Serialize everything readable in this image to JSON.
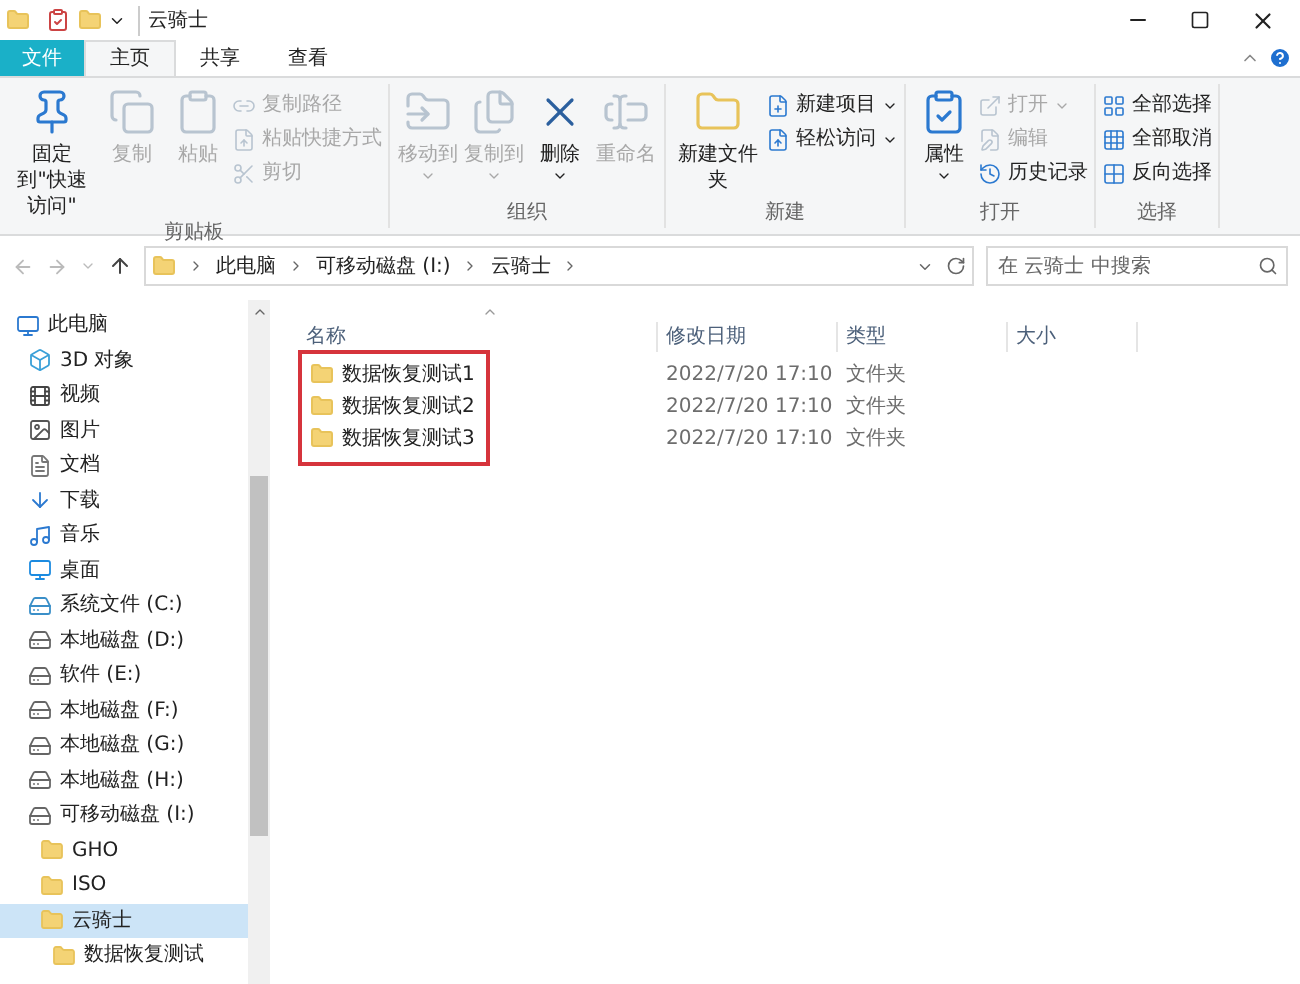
{
  "title_bar": {
    "title": "云骑士"
  },
  "tabs": [
    {
      "label": "文件",
      "kind": "file",
      "selected": false
    },
    {
      "label": "主页",
      "kind": "tab",
      "selected": true
    },
    {
      "label": "共享",
      "kind": "tab",
      "selected": false
    },
    {
      "label": "查看",
      "kind": "tab",
      "selected": false
    }
  ],
  "ribbon": [
    {
      "label": "剪贴板",
      "items": [
        {
          "label": "固定到\"快速访问\"",
          "kind": "large",
          "disabled": false,
          "dropdown": false
        },
        {
          "label": "复制",
          "kind": "large",
          "disabled": true,
          "dropdown": false
        },
        {
          "label": "粘贴",
          "kind": "large",
          "disabled": true,
          "dropdown": false
        },
        {
          "label": "复制路径",
          "kind": "small",
          "disabled": true,
          "dropdown": false
        },
        {
          "label": "粘贴快捷方式",
          "kind": "small",
          "disabled": true,
          "dropdown": false
        },
        {
          "label": "剪切",
          "kind": "small",
          "disabled": true,
          "dropdown": false
        }
      ]
    },
    {
      "label": "组织",
      "items": [
        {
          "label": "移动到",
          "kind": "large",
          "disabled": true,
          "dropdown": true
        },
        {
          "label": "复制到",
          "kind": "large",
          "disabled": true,
          "dropdown": true
        },
        {
          "label": "删除",
          "kind": "large",
          "disabled": false,
          "dropdown": true
        },
        {
          "label": "重命名",
          "kind": "large",
          "disabled": true,
          "dropdown": false
        }
      ]
    },
    {
      "label": "新建",
      "items": [
        {
          "label": "新建文件夹",
          "kind": "large",
          "disabled": false,
          "dropdown": false
        },
        {
          "label": "新建项目",
          "kind": "small",
          "disabled": false,
          "dropdown": true
        },
        {
          "label": "轻松访问",
          "kind": "small",
          "disabled": false,
          "dropdown": true
        }
      ]
    },
    {
      "label": "打开",
      "items": [
        {
          "label": "属性",
          "kind": "large",
          "disabled": false,
          "dropdown": true
        },
        {
          "label": "打开",
          "kind": "small",
          "disabled": true,
          "dropdown": true
        },
        {
          "label": "编辑",
          "kind": "small",
          "disabled": true,
          "dropdown": false
        },
        {
          "label": "历史记录",
          "kind": "small",
          "disabled": false,
          "dropdown": false
        }
      ]
    },
    {
      "label": "选择",
      "items": [
        {
          "label": "全部选择",
          "kind": "small",
          "disabled": false,
          "dropdown": false
        },
        {
          "label": "全部取消",
          "kind": "small",
          "disabled": false,
          "dropdown": false
        },
        {
          "label": "反向选择",
          "kind": "small",
          "disabled": false,
          "dropdown": false
        }
      ]
    }
  ],
  "address_bar": {
    "path": [
      "此电脑",
      "可移动磁盘 (I:)",
      "云骑士"
    ]
  },
  "search": {
    "placeholder": "在 云骑士 中搜索"
  },
  "sidebar": {
    "items": [
      {
        "label": "此电脑",
        "kind": "pc",
        "selected": false,
        "children": [
          {
            "label": "3D 对象",
            "kind": "object",
            "selected": false
          },
          {
            "label": "视频",
            "kind": "video",
            "selected": false
          },
          {
            "label": "图片",
            "kind": "picture",
            "selected": false
          },
          {
            "label": "文档",
            "kind": "document",
            "selected": false
          },
          {
            "label": "下载",
            "kind": "download",
            "selected": false
          },
          {
            "label": "音乐",
            "kind": "music",
            "selected": false
          },
          {
            "label": "桌面",
            "kind": "desktop",
            "selected": false
          },
          {
            "label": "系统文件 (C:)",
            "kind": "system-drive",
            "selected": false
          },
          {
            "label": "本地磁盘 (D:)",
            "kind": "drive",
            "selected": false
          },
          {
            "label": "软件 (E:)",
            "kind": "drive",
            "selected": false
          },
          {
            "label": "本地磁盘 (F:)",
            "kind": "drive",
            "selected": false
          },
          {
            "label": "本地磁盘 (G:)",
            "kind": "drive",
            "selected": false
          },
          {
            "label": "本地磁盘 (H:)",
            "kind": "drive",
            "selected": false
          },
          {
            "label": "可移动磁盘 (I:)",
            "kind": "drive",
            "selected": false,
            "children": [
              {
                "label": "GHO",
                "kind": "folder",
                "selected": false
              },
              {
                "label": "ISO",
                "kind": "folder",
                "selected": false
              },
              {
                "label": "云骑士",
                "kind": "folder",
                "selected": true,
                "children": [
                  {
                    "label": "数据恢复测试",
                    "kind": "folder",
                    "selected": false
                  }
                ]
              }
            ]
          }
        ]
      }
    ]
  },
  "table": {
    "columns": [
      "名称",
      "修改日期",
      "类型",
      "大小"
    ],
    "highlighted": true,
    "rows": [
      {
        "name": "数据恢复测试1",
        "modified": "2022/7/20 17:10",
        "type": "文件夹"
      },
      {
        "name": "数据恢复测试2",
        "modified": "2022/7/20 17:10",
        "type": "文件夹"
      },
      {
        "name": "数据恢复测试3",
        "modified": "2022/7/20 17:10",
        "type": "文件夹"
      }
    ]
  }
}
